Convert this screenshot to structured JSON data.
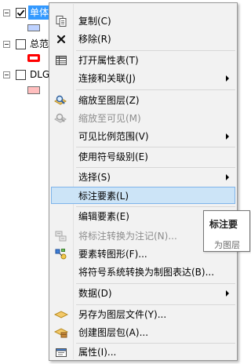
{
  "toc": {
    "layers": [
      {
        "name": "单体化数据",
        "checked": true,
        "selected": true
      },
      {
        "name": "总范",
        "checked": false,
        "selected": false
      },
      {
        "name": "DLG",
        "checked": false,
        "selected": false
      }
    ]
  },
  "menu": {
    "items": [
      {
        "label": "复制(C)",
        "icon": "copy-icon",
        "enabled": true,
        "submenu": false
      },
      {
        "label": "移除(R)",
        "icon": "remove-x-icon",
        "enabled": true,
        "submenu": false
      },
      {
        "label": "打开属性表(T)",
        "icon": "attribute-table-icon",
        "enabled": true,
        "submenu": false
      },
      {
        "label": "连接和关联(J)",
        "icon": "",
        "enabled": true,
        "submenu": true
      },
      {
        "label": "缩放至图层(Z)",
        "icon": "zoom-to-layer-icon",
        "enabled": true,
        "submenu": false
      },
      {
        "label": "缩放至可见(M)",
        "icon": "zoom-to-visible-icon",
        "enabled": false,
        "submenu": false
      },
      {
        "label": "可见比例范围(V)",
        "icon": "",
        "enabled": true,
        "submenu": true
      },
      {
        "label": "使用符号级别(E)",
        "icon": "",
        "enabled": true,
        "submenu": false
      },
      {
        "label": "选择(S)",
        "icon": "",
        "enabled": true,
        "submenu": true
      },
      {
        "label": "标注要素(L)",
        "icon": "",
        "enabled": true,
        "submenu": false,
        "highlighted": true
      },
      {
        "label": "编辑要素(E)",
        "icon": "",
        "enabled": true,
        "submenu": false
      },
      {
        "label": "将标注转换为注记(N)...",
        "icon": "convert-labels-icon",
        "enabled": false,
        "submenu": false
      },
      {
        "label": "要素转图形(F)...",
        "icon": "features-to-graphics-icon",
        "enabled": true,
        "submenu": false
      },
      {
        "label": "将符号系统转换为制图表达(B)...",
        "icon": "",
        "enabled": true,
        "submenu": false
      },
      {
        "label": "数据(D)",
        "icon": "",
        "enabled": true,
        "submenu": true
      },
      {
        "label": "另存为图层文件(Y)...",
        "icon": "layer-file-icon",
        "enabled": true,
        "submenu": false
      },
      {
        "label": "创建图层包(A)...",
        "icon": "layer-package-icon",
        "enabled": true,
        "submenu": false
      },
      {
        "label": "属性(I)...",
        "icon": "properties-icon",
        "enabled": true,
        "submenu": false
      }
    ]
  },
  "tooltip": {
    "title": "标注要",
    "body": "为图层"
  },
  "colors": {
    "selection": "#3399ff",
    "menu_bg": "#f2f2f2",
    "highlight_bg": "#cce4f7",
    "highlight_border": "#7eb4ea",
    "symbol_blue_fill": "#bed2ff",
    "symbol_red_outline": "#ff0000",
    "symbol_pink_fill": "#ffbebe"
  }
}
